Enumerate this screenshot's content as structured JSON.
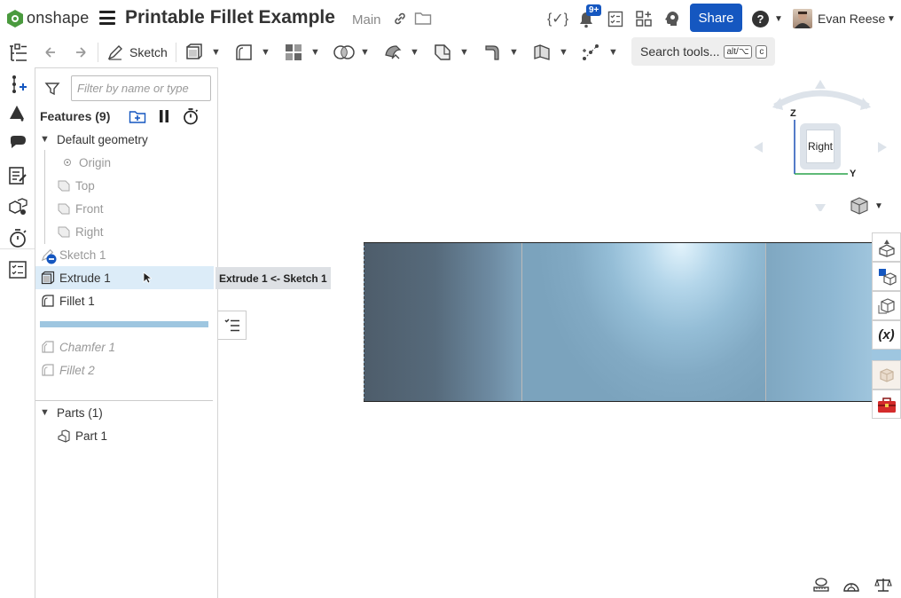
{
  "app": {
    "logo_text": "onshape",
    "document_title": "Printable Fillet Example",
    "branch": "Main"
  },
  "header": {
    "variables_icon": "{✓}",
    "notification_badge": "9+",
    "share_label": "Share",
    "help_label": "?",
    "user_name": "Evan Reese"
  },
  "toolbar": {
    "sketch_label": "Sketch",
    "search_label": "Search tools...",
    "search_shortcut_1": "alt/⌥",
    "search_shortcut_2": "c"
  },
  "panel": {
    "filter_placeholder": "Filter by name or type",
    "features_title": "Features (9)",
    "default_geometry": "Default geometry",
    "origin": "Origin",
    "top": "Top",
    "front": "Front",
    "right": "Right",
    "features": [
      {
        "label": "Sketch 1",
        "state": "greyed"
      },
      {
        "label": "Extrude 1",
        "state": "selected"
      },
      {
        "label": "Fillet 1",
        "state": "normal"
      },
      {
        "label": "Chamfer 1",
        "state": "rolled-back"
      },
      {
        "label": "Fillet 2",
        "state": "rolled-back"
      }
    ],
    "parts_title": "Parts (1)",
    "part_1": "Part 1"
  },
  "tooltip": {
    "text": "Extrude 1 <- Sketch 1"
  },
  "viewcube": {
    "face_label": "Right",
    "axis_z": "Z",
    "axis_y": "Y"
  },
  "right_dock": {
    "variables_label": "(x)"
  },
  "colors": {
    "accent": "#1557c0",
    "selection": "#dcecf8",
    "rollback_bar": "#9ec6e0",
    "axis_z": "#1a4fb5",
    "axis_y": "#2aa34a"
  }
}
